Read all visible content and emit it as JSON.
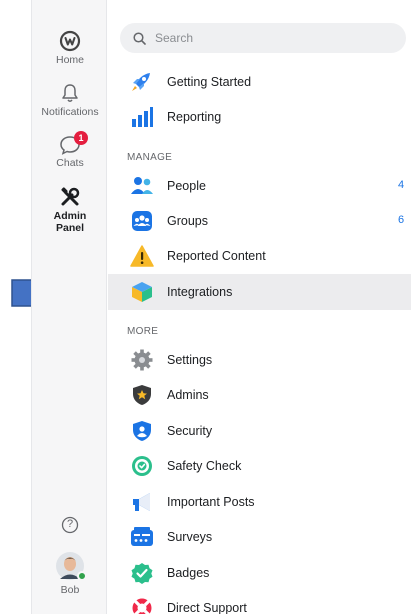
{
  "rail": {
    "home_label": "Home",
    "notifications_label": "Notifications",
    "chats_label": "Chats",
    "chats_badge": "1",
    "admin_label_line1": "Admin",
    "admin_label_line2": "Panel",
    "help_glyph": "?",
    "user_name": "Bob"
  },
  "search": {
    "placeholder": "Search"
  },
  "menu": {
    "top_items": [
      {
        "label": "Getting Started",
        "icon": "rocket-icon"
      },
      {
        "label": "Reporting",
        "icon": "bar-chart-icon"
      }
    ],
    "manage_header": "MANAGE",
    "manage_items": [
      {
        "label": "People",
        "icon": "people-icon",
        "count": "4"
      },
      {
        "label": "Groups",
        "icon": "groups-icon",
        "count": "6"
      },
      {
        "label": "Reported Content",
        "icon": "warning-icon"
      },
      {
        "label": "Integrations",
        "icon": "cube-icon",
        "selected": true
      }
    ],
    "more_header": "MORE",
    "more_items": [
      {
        "label": "Settings",
        "icon": "gear-icon"
      },
      {
        "label": "Admins",
        "icon": "admin-shield-icon"
      },
      {
        "label": "Security",
        "icon": "security-shield-icon"
      },
      {
        "label": "Safety Check",
        "icon": "safety-check-icon"
      },
      {
        "label": "Important Posts",
        "icon": "megaphone-icon"
      },
      {
        "label": "Surveys",
        "icon": "survey-icon"
      },
      {
        "label": "Badges",
        "icon": "badge-icon"
      },
      {
        "label": "Direct Support",
        "icon": "lifebuoy-icon"
      }
    ]
  },
  "colors": {
    "accent_blue": "#1b74e4",
    "badge_red": "#e41e3f",
    "arrow_blue": "#4472c4",
    "selected_bg": "#ececee"
  }
}
